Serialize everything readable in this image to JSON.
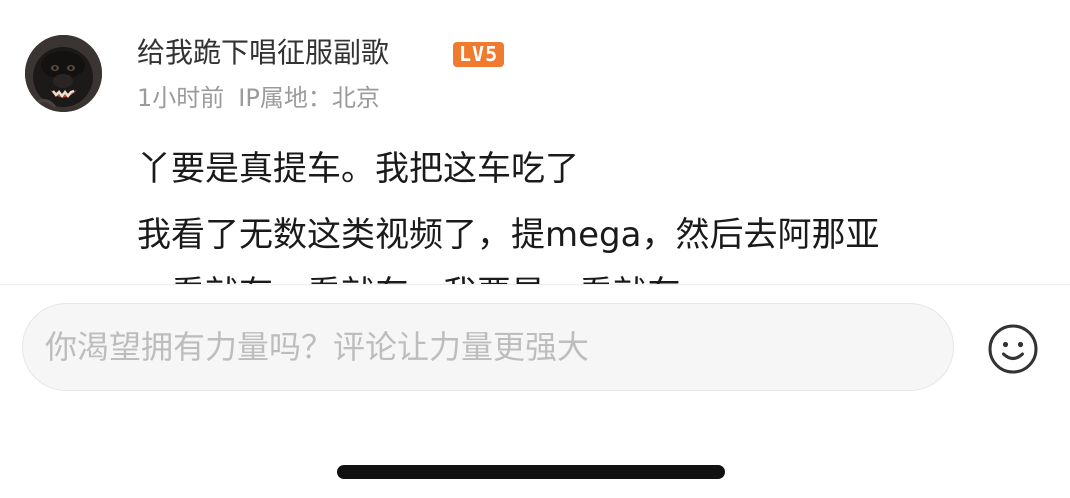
{
  "comment": {
    "avatar_icon": "gorilla-avatar-icon",
    "username": "给我跪下唱征服副歌",
    "level_badge": "LV5",
    "time": "1小时前",
    "ip_location": "IP属地：北京",
    "lines": [
      "丫要是真提车。我把这车吃了",
      "我看了无数这类视频了，提mega，然后去阿那亚",
      "一看就有一看就车，我要是一看就车"
    ]
  },
  "input_bar": {
    "placeholder": "你渴望拥有力量吗？评论让力量更强大",
    "emoji_icon": "smiley-face-icon"
  },
  "colors": {
    "badge": "#f07a2e",
    "meta_text": "#9b9b9b",
    "placeholder": "#bdbdbd",
    "home_indicator": "#111111"
  }
}
